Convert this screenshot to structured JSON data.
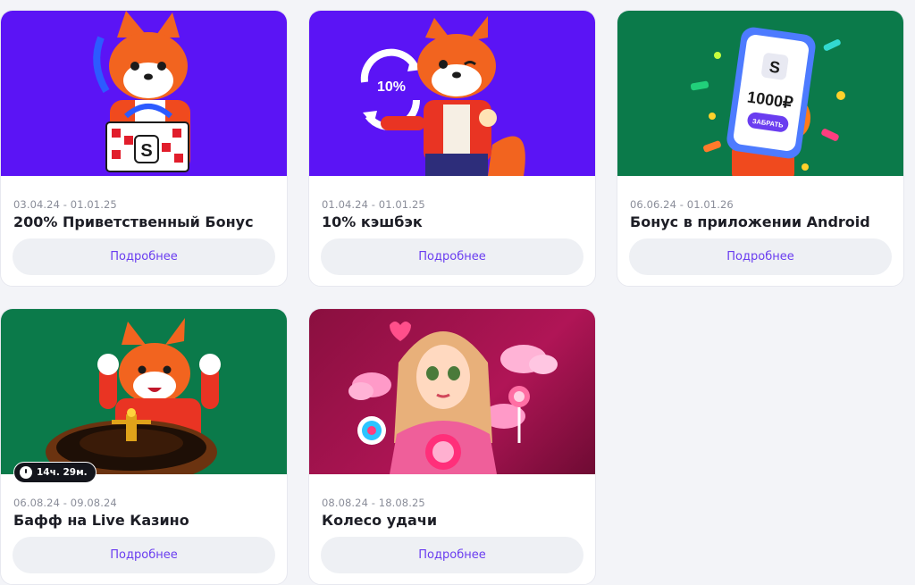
{
  "cards": [
    {
      "dates": "03.04.24 - 01.01.25",
      "title": "200% Приветственный Бонус",
      "button": "Подробнее",
      "art": "fox-gift",
      "bg": "#5b14f5"
    },
    {
      "dates": "01.04.24 - 01.01.25",
      "title": "10% кэшбэк",
      "button": "Подробнее",
      "art": "fox-cashback",
      "bg": "#5b14f5",
      "badge": "10%"
    },
    {
      "dates": "06.06.24 - 01.01.26",
      "title": "Бонус в приложении Android",
      "button": "Подробнее",
      "art": "phone-bonus",
      "bg": "#0b7a4a",
      "phone_amount": "1000₽",
      "phone_button": "ЗАБРАТЬ",
      "phone_logo": "S"
    },
    {
      "dates": "06.08.24 - 09.08.24",
      "title": "Бафф на Live Казино",
      "button": "Подробнее",
      "art": "fox-roulette",
      "bg": "#0b7a4a",
      "timer": "14ч. 29м."
    },
    {
      "dates": "08.08.24 - 18.08.25",
      "title": "Колесо удачи",
      "button": "Подробнее",
      "art": "girl-wheel",
      "bg": "#8a0f3f"
    }
  ],
  "colors": {
    "accent": "#6a3df0",
    "purple_bg": "#5b14f5",
    "green_bg": "#0b7a4a",
    "magenta_bg": "#8a0f3f"
  }
}
